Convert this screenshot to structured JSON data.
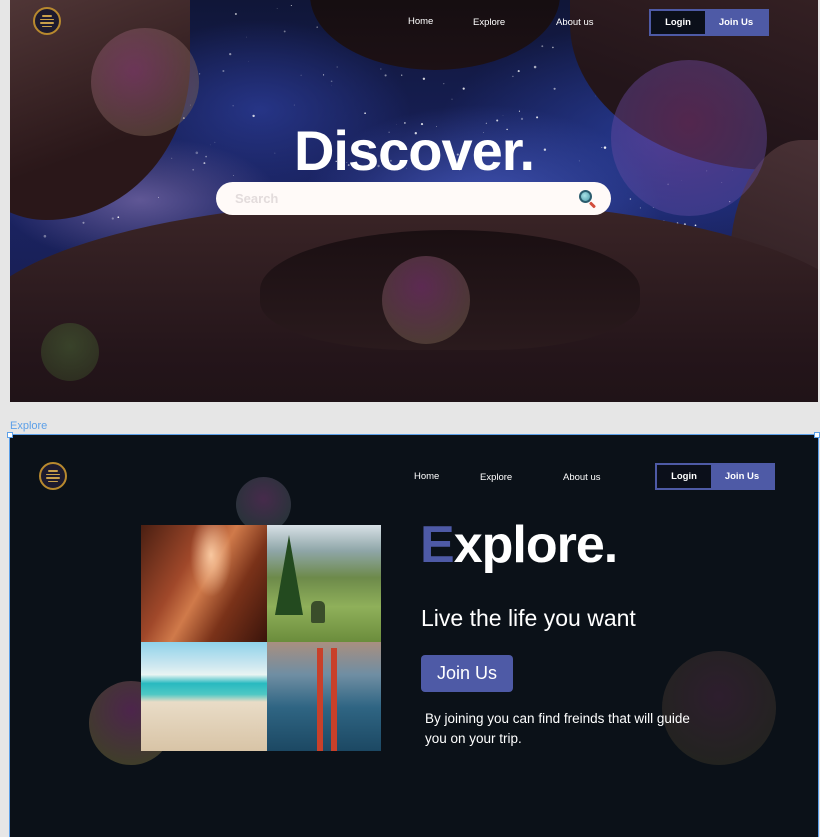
{
  "discover_frame": {
    "nav": {
      "home": "Home",
      "explore": "Explore",
      "about": "About us"
    },
    "auth": {
      "login": "Login",
      "join": "Join Us"
    },
    "title": "Discover.",
    "search": {
      "placeholder": "Search",
      "value": ""
    }
  },
  "explore_frame_label": "Explore",
  "explore_frame": {
    "nav": {
      "home": "Home",
      "explore": "Explore",
      "about": "About us"
    },
    "auth": {
      "login": "Login",
      "join": "Join Us"
    },
    "title_accent": "E",
    "title_rest": "xplore.",
    "tagline": "Live the life you want",
    "cta": "Join Us",
    "description": "By joining you can find freinds that will guide you on your trip."
  },
  "colors": {
    "accent": "#4e5aa6",
    "dark_bg": "#0b1118",
    "selection": "#5da0e8"
  },
  "icons": {
    "logo": "logo-icon",
    "search": "search-icon"
  }
}
